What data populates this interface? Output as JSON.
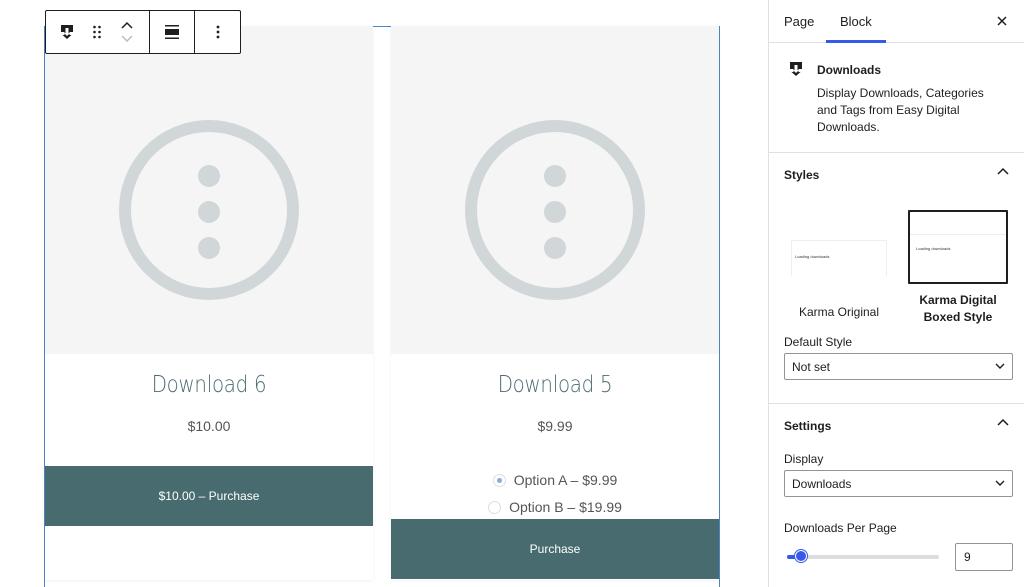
{
  "toolbar": {
    "block_icon": "download-icon",
    "drag_icon": "drag-handle-icon",
    "move_up_icon": "chevron-up-icon",
    "move_down_icon": "chevron-down-icon",
    "align_icon": "align-wide-icon",
    "more_icon": "more-vertical-icon"
  },
  "downloads": [
    {
      "title": "Download 6",
      "price": "$10.00",
      "button": "$10.00 – Purchase"
    },
    {
      "title": "Download 5",
      "price": "$9.99",
      "options": [
        {
          "label": "Option A – $9.99",
          "checked": true
        },
        {
          "label": "Option B – $19.99",
          "checked": false
        }
      ],
      "button": "Purchase"
    }
  ],
  "sidebar": {
    "tabs": {
      "page": "Page",
      "block": "Block"
    },
    "block_card": {
      "name": "Downloads",
      "description": "Display Downloads, Categories and Tags from Easy Digital Downloads."
    },
    "styles": {
      "heading": "Styles",
      "options": [
        {
          "label": "Karma Original",
          "preview_text": "Loading downloads",
          "selected": false
        },
        {
          "label": "Karma Digital Boxed Style",
          "preview_text": "Loading downloads",
          "selected": true
        }
      ],
      "default_style_label": "Default Style",
      "default_style_value": "Not set"
    },
    "settings": {
      "heading": "Settings",
      "display_label": "Display",
      "display_value": "Downloads",
      "per_page_label": "Downloads Per Page",
      "per_page_value": "9",
      "per_page_slider_fraction": 0.09
    }
  },
  "colors": {
    "accent": "#3858e9",
    "button_bg": "#476b6e",
    "title_color": "#4a6b6f",
    "placeholder_gray": "#d1d6d9"
  }
}
